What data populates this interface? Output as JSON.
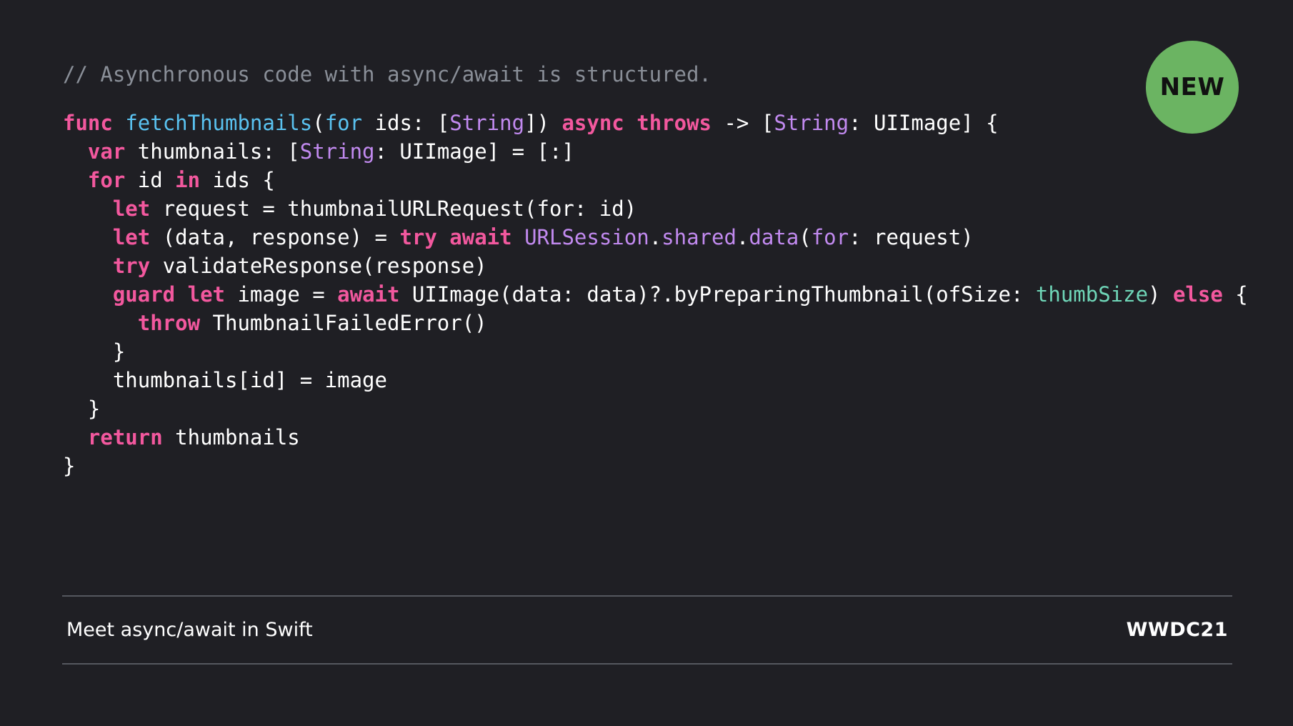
{
  "slide": {
    "badge_label": "NEW",
    "footer_title": "Meet async/await in Swift",
    "footer_event": "WWDC21"
  },
  "colors": {
    "background": "#1f1f24",
    "comment": "#8a8f98",
    "keyword": "#f2589e",
    "function_declaration": "#5ac2f0",
    "type": "#c28af0",
    "variable": "#6fd6b8",
    "plain": "#ffffff",
    "badge": "#6bb462",
    "divider": "#55585f"
  },
  "code": {
    "language": "Swift",
    "lines": [
      {
        "cls": "comment-line",
        "tokens": [
          {
            "t": "// Asynchronous code with async/await is structured.",
            "k": "comment"
          }
        ]
      },
      {
        "tokens": [
          {
            "t": "func",
            "k": "keyword"
          },
          {
            "t": " ",
            "k": "plain"
          },
          {
            "t": "fetchThumbnails",
            "k": "fn-decl"
          },
          {
            "t": "(",
            "k": "plain"
          },
          {
            "t": "for",
            "k": "fn-decl"
          },
          {
            "t": " ids: [",
            "k": "plain"
          },
          {
            "t": "String",
            "k": "type"
          },
          {
            "t": "]) ",
            "k": "plain"
          },
          {
            "t": "async",
            "k": "keyword"
          },
          {
            "t": " ",
            "k": "plain"
          },
          {
            "t": "throws",
            "k": "keyword"
          },
          {
            "t": " -> [",
            "k": "plain"
          },
          {
            "t": "String",
            "k": "type"
          },
          {
            "t": ": UIImage] {",
            "k": "plain"
          }
        ]
      },
      {
        "tokens": [
          {
            "t": "  ",
            "k": "plain"
          },
          {
            "t": "var",
            "k": "keyword"
          },
          {
            "t": " thumbnails: [",
            "k": "plain"
          },
          {
            "t": "String",
            "k": "type"
          },
          {
            "t": ": UIImage] = [:]",
            "k": "plain"
          }
        ]
      },
      {
        "tokens": [
          {
            "t": "  ",
            "k": "plain"
          },
          {
            "t": "for",
            "k": "keyword"
          },
          {
            "t": " id ",
            "k": "plain"
          },
          {
            "t": "in",
            "k": "keyword"
          },
          {
            "t": " ids {",
            "k": "plain"
          }
        ]
      },
      {
        "tokens": [
          {
            "t": "    ",
            "k": "plain"
          },
          {
            "t": "let",
            "k": "keyword"
          },
          {
            "t": " request = thumbnailURLRequest(for: id)",
            "k": "plain"
          }
        ]
      },
      {
        "tokens": [
          {
            "t": "    ",
            "k": "plain"
          },
          {
            "t": "let",
            "k": "keyword"
          },
          {
            "t": " (data, response) = ",
            "k": "plain"
          },
          {
            "t": "try",
            "k": "keyword"
          },
          {
            "t": " ",
            "k": "plain"
          },
          {
            "t": "await",
            "k": "keyword"
          },
          {
            "t": " ",
            "k": "plain"
          },
          {
            "t": "URLSession",
            "k": "type"
          },
          {
            "t": ".",
            "k": "plain"
          },
          {
            "t": "shared",
            "k": "member"
          },
          {
            "t": ".",
            "k": "plain"
          },
          {
            "t": "data",
            "k": "member"
          },
          {
            "t": "(",
            "k": "plain"
          },
          {
            "t": "for",
            "k": "type"
          },
          {
            "t": ": request)",
            "k": "plain"
          }
        ]
      },
      {
        "tokens": [
          {
            "t": "    ",
            "k": "plain"
          },
          {
            "t": "try",
            "k": "keyword"
          },
          {
            "t": " validateResponse(response)",
            "k": "plain"
          }
        ]
      },
      {
        "tokens": [
          {
            "t": "    ",
            "k": "plain"
          },
          {
            "t": "guard",
            "k": "keyword"
          },
          {
            "t": " ",
            "k": "plain"
          },
          {
            "t": "let",
            "k": "keyword"
          },
          {
            "t": " image = ",
            "k": "plain"
          },
          {
            "t": "await",
            "k": "keyword"
          },
          {
            "t": " UIImage(data: data)?.byPreparingThumbnail(ofSize: ",
            "k": "plain"
          },
          {
            "t": "thumbSize",
            "k": "var"
          },
          {
            "t": ") ",
            "k": "plain"
          },
          {
            "t": "else",
            "k": "keyword"
          },
          {
            "t": " {",
            "k": "plain"
          }
        ]
      },
      {
        "tokens": [
          {
            "t": "      ",
            "k": "plain"
          },
          {
            "t": "throw",
            "k": "keyword"
          },
          {
            "t": " ThumbnailFailedError()",
            "k": "plain"
          }
        ]
      },
      {
        "tokens": [
          {
            "t": "    }",
            "k": "plain"
          }
        ]
      },
      {
        "tokens": [
          {
            "t": "    thumbnails[id] = image",
            "k": "plain"
          }
        ]
      },
      {
        "tokens": [
          {
            "t": "  }",
            "k": "plain"
          }
        ]
      },
      {
        "tokens": [
          {
            "t": "  ",
            "k": "plain"
          },
          {
            "t": "return",
            "k": "keyword"
          },
          {
            "t": " thumbnails",
            "k": "plain"
          }
        ]
      },
      {
        "tokens": [
          {
            "t": "}",
            "k": "plain"
          }
        ]
      }
    ]
  }
}
